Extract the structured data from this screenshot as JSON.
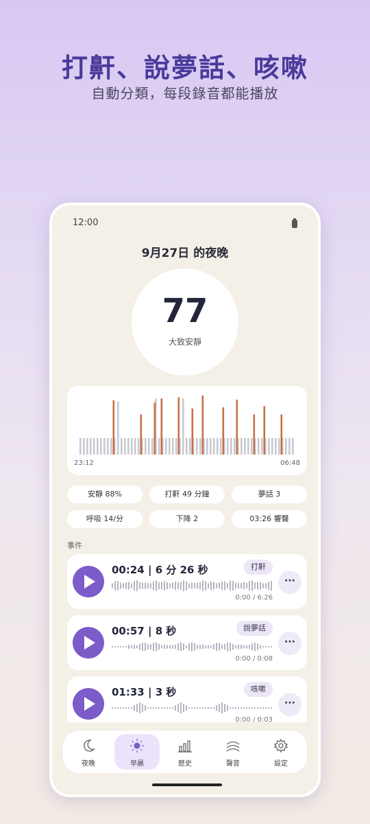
{
  "promo": {
    "headline": "打鼾、說夢話、咳嗽",
    "subline": "自動分類，每段錄音都能播放"
  },
  "status_bar": {
    "time": "12:00"
  },
  "night": {
    "title": "9月27日 的夜晚"
  },
  "score": {
    "value": "77",
    "label": "大致安靜"
  },
  "chart_data": {
    "type": "bar",
    "x_start": "23:12",
    "x_end": "06:48",
    "series": [
      {
        "color": "#c8c8d2",
        "values": [
          0.28,
          0.28,
          0.28,
          0.28,
          0.28,
          0.28,
          0.28,
          0.28,
          0.28,
          0.28,
          0.28,
          0.9,
          0.28,
          0.28,
          0.28,
          0.28,
          0.28,
          0.28,
          0.28,
          0.28,
          0.28,
          0.28,
          0.95,
          0.28,
          0.28,
          0.28,
          0.28,
          0.28,
          0.28,
          0.28,
          0.95,
          0.28,
          0.28,
          0.28,
          0.28,
          0.28,
          0.28,
          0.28,
          0.28,
          0.28,
          0.28,
          0.28,
          0.28,
          0.28,
          0.28,
          0.28,
          0.28,
          0.28,
          0.28,
          0.28,
          0.28,
          0.28,
          0.28,
          0.28,
          0.28,
          0.28,
          0.28,
          0.28,
          0.28,
          0.28,
          0.28,
          0.28,
          0.28
        ]
      },
      {
        "color": "#c96f45",
        "values": [
          0,
          0,
          0,
          0,
          0,
          0,
          0,
          0,
          0,
          0,
          0.92,
          0,
          0,
          0,
          0,
          0,
          0,
          0,
          0.68,
          0,
          0,
          0,
          0.88,
          0,
          0.95,
          0,
          0,
          0,
          0,
          0.97,
          0,
          0,
          0,
          0.78,
          0,
          0,
          1.0,
          0,
          0,
          0,
          0,
          0,
          0.8,
          0,
          0,
          0,
          0.93,
          0,
          0,
          0,
          0,
          0.68,
          0,
          0,
          0.82,
          0,
          0,
          0,
          0,
          0.68,
          0,
          0,
          0
        ]
      }
    ]
  },
  "stats": [
    {
      "label": "安靜 88%"
    },
    {
      "label": "打鼾 49 分鐘"
    },
    {
      "label": "夢話 3"
    },
    {
      "label": "呼吸 14/分"
    },
    {
      "label": "下降 2"
    },
    {
      "label": "03:26 響聲"
    }
  ],
  "events_label": "事件",
  "events": [
    {
      "time": "00:24",
      "duration": "6 分 26 秒",
      "tag": "打鼾",
      "progress": "0:00 / 6:26",
      "more": "···"
    },
    {
      "time": "00:57",
      "duration": "8 秒",
      "tag": "說夢話",
      "progress": "0:00 / 0:08",
      "more": "···"
    },
    {
      "time": "01:33",
      "duration": "3 秒",
      "tag": "咳嗽",
      "progress": "0:00 / 0:03",
      "more": "···"
    }
  ],
  "tabs": [
    {
      "label": "夜晚",
      "icon": "moon-icon",
      "active": false
    },
    {
      "label": "早晨",
      "icon": "sun-icon",
      "active": true
    },
    {
      "label": "歷史",
      "icon": "bar-chart-icon",
      "active": false
    },
    {
      "label": "聲音",
      "icon": "sound-waves-icon",
      "active": false
    },
    {
      "label": "設定",
      "icon": "gear-icon",
      "active": false
    }
  ],
  "colors": {
    "accent": "#7b5cc8",
    "snore": "#c96f45",
    "quiet": "#c8c8d2",
    "headline": "#4a3a9a"
  }
}
